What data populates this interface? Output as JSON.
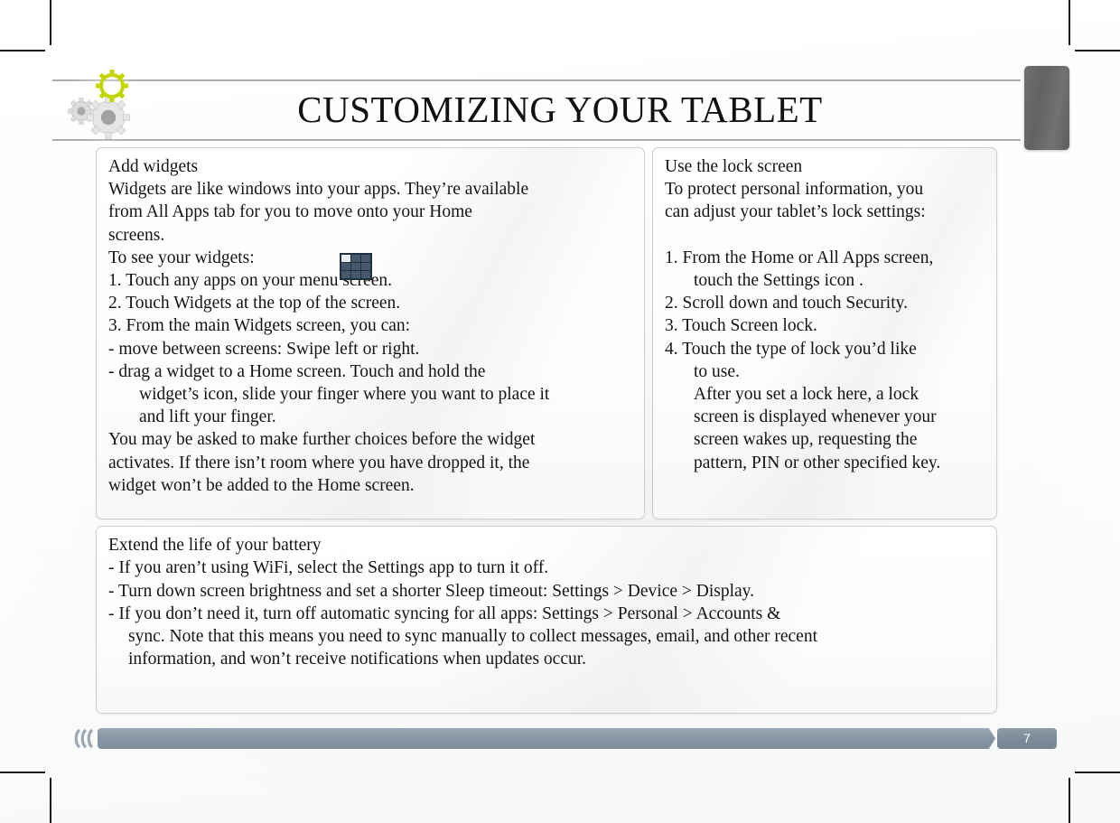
{
  "document": {
    "title": "CUSTOMIZING YOUR TABLET",
    "page_number": "7"
  },
  "theme": {
    "accent_lime": "#c3d600",
    "gear_gray": "#9b9b9b",
    "gear_light": "#e2e2e2",
    "footer_bar": "#8796a4",
    "header_tab": "#6b6b6b",
    "box_border": "#cfcfcf",
    "text": "#141414"
  },
  "icons": {
    "gear_large": "gear-icon",
    "gear_small": "gear-icon",
    "gear_lime": "gear-icon",
    "apps_grid": "apps-grid-icon",
    "footer_chevrons": "chevrons-left-icon"
  },
  "boxes": {
    "left": {
      "heading": "Add widgets",
      "lines": [
        "Widgets are like windows into your apps. They’re available",
        "from All Apps tab for you to move onto your Home",
        "screens.",
        "To see your widgets:",
        "1. Touch any apps on your menu screen.",
        "2. Touch Widgets at the top of the screen.",
        "3. From the main Widgets screen, you can:",
        "- move between screens: Swipe left or right.",
        "- drag a widget to a Home screen. Touch and hold the",
        "widget’s icon, slide your finger where you want to place it",
        "and lift your finger.",
        "You may be asked to make further choices before the widget",
        "activates. If there isn’t room where you have dropped it, the",
        "widget won’t be added to the Home screen."
      ]
    },
    "right": {
      "heading": "Use the lock screen",
      "lines": [
        "To protect personal information, you",
        "can adjust your tablet’s lock settings:",
        "",
        "1. From the Home or All Apps screen,",
        "touch the Settings icon .",
        "2. Scroll down and touch Security.",
        "3. Touch Screen lock.",
        "4. Touch the type of lock you’d like",
        "to use.",
        "After you set a lock here, a lock",
        "screen is displayed whenever your",
        "screen wakes up, requesting the",
        "pattern, PIN or other specified key."
      ]
    },
    "bottom": {
      "heading": "Extend the life of your battery",
      "lines": [
        "- If you aren’t using WiFi, select the Settings app to turn it off.",
        "- Turn down screen brightness and set a shorter Sleep timeout: Settings > Device > Display.",
        "- If you don’t need it, turn off automatic syncing for all apps: Settings > Personal > Accounts &",
        "sync. Note that this means you need to sync manually to collect messages, email, and other recent",
        "information, and won’t receive notifications when updates occur."
      ]
    }
  }
}
